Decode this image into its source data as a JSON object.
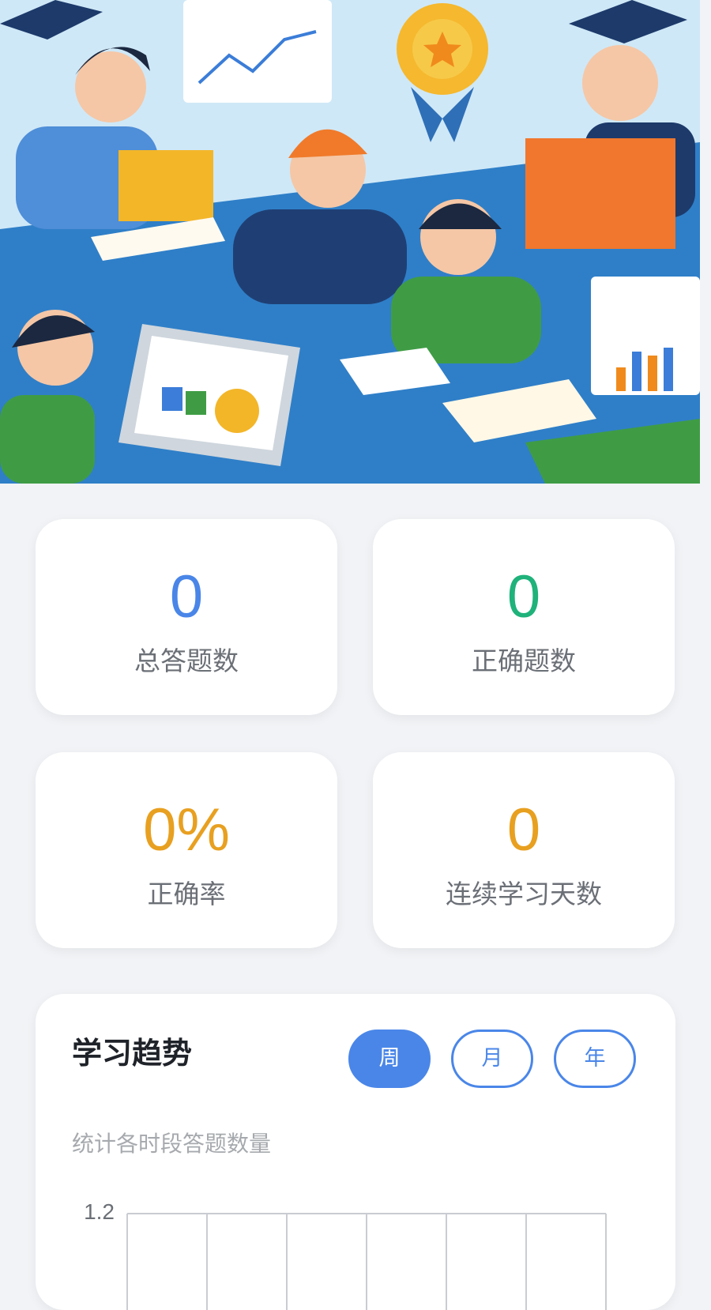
{
  "colors": {
    "accent_blue": "#4a86e8",
    "accent_green": "#1fb27a",
    "accent_orange": "#e8a020",
    "label_gray": "#6b6f76"
  },
  "hero": {
    "icon": "students-studying-illustration"
  },
  "stats": {
    "total": {
      "value": "0",
      "label": "总答题数"
    },
    "correct": {
      "value": "0",
      "label": "正确题数"
    },
    "rate": {
      "value": "0%",
      "label": "正确率"
    },
    "streak": {
      "value": "0",
      "label": "连续学习天数"
    }
  },
  "trend": {
    "title": "学习趋势",
    "periods": [
      "周",
      "月",
      "年"
    ],
    "active_period": "周",
    "subtitle": "统计各时段答题数量"
  },
  "chart_data": {
    "type": "bar",
    "y_tick_labels": [
      "1.2"
    ],
    "grid": true
  }
}
